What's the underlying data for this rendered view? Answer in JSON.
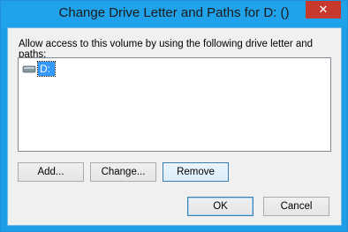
{
  "window": {
    "title": "Change Drive Letter and Paths for D: ()",
    "close_glyph": "✕"
  },
  "dialog": {
    "description": "Allow access to this volume by using the following drive letter and paths:",
    "list_items": [
      {
        "label": "D:",
        "icon": "drive-icon"
      }
    ]
  },
  "buttons": {
    "add": "Add...",
    "change": "Change...",
    "remove": "Remove",
    "ok": "OK",
    "cancel": "Cancel"
  }
}
